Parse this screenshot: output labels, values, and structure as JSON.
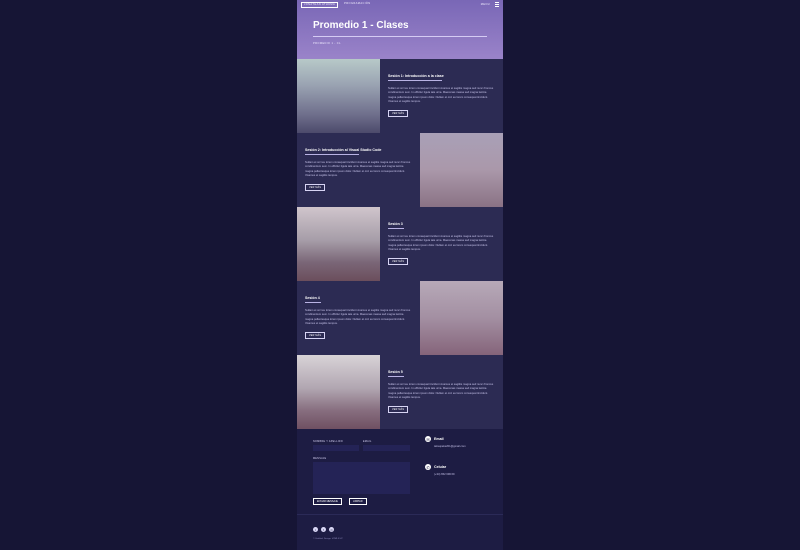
{
  "nav": {
    "left": [
      "JONATHAN ATHUMA",
      "PROGRAMACIÓN"
    ],
    "right": "MENU",
    "menu_icon": "menu-icon"
  },
  "hero": {
    "title": "Promedio 1 - Clases",
    "breadcrumb": "PROMEDIO 1 - CL"
  },
  "sections": [
    {
      "title": "Sesión 1: Introducción a la clase",
      "text": "Nullam et orci eu lorem consequat tincidunt vivamus et sagittis magna sed nunc rhoncus condimentum sem. In efficitur ligula tate urna. Maecenas massa sed magna lacinia magna pellentesque lorem ipsum dolor. Nullam et orci eu lorem consequat tincidunt. Vivamus et sagittis tempus.",
      "button": "VER MÁS"
    },
    {
      "title": "Sesión 2: Introducción al Visual Studio Code",
      "text": "Nullam et orci eu lorem consequat tincidunt vivamus et sagittis magna sed nunc rhoncus condimentum sem. In efficitur ligula tate urna. Maecenas massa sed magna lacinia magna pellentesque lorem ipsum dolor. Nullam et orci eu lorem consequat tincidunt. Vivamus et sagittis tempus.",
      "button": "VER MÁS"
    },
    {
      "title": "Sesión 3",
      "text": "Nullam et orci eu lorem consequat tincidunt vivamus et sagittis magna sed nunc rhoncus condimentum sem. In efficitur ligula tate urna. Maecenas massa sed magna lacinia magna pellentesque lorem ipsum dolor. Nullam et orci eu lorem consequat tincidunt. Vivamus et sagittis tempus.",
      "button": "VER MÁS"
    },
    {
      "title": "Sesión 4",
      "text": "Nullam et orci eu lorem consequat tincidunt vivamus et sagittis magna sed nunc rhoncus condimentum sem. In efficitur ligula tate urna. Maecenas massa sed magna lacinia magna pellentesque lorem ipsum dolor. Nullam et orci eu lorem consequat tincidunt. Vivamus et sagittis tempus.",
      "button": "VER MÁS"
    },
    {
      "title": "Sesión 5",
      "text": "Nullam et orci eu lorem consequat tincidunt vivamus et sagittis magna sed nunc rhoncus condimentum sem. In efficitur ligula tate urna. Maecenas massa sed magna lacinia magna pellentesque lorem ipsum dolor. Nullam et orci eu lorem consequat tincidunt. Vivamus et sagittis tempus.",
      "button": "VER MÁS"
    }
  ],
  "contact": {
    "name_label": "NOMBRE Y APELLIDO",
    "email_label": "EMAIL",
    "message_label": "MENSAJE",
    "send_button": "ENVIAR MENSAJE",
    "clear_button": "LIMPIAR",
    "email_title": "Email",
    "email_value": "teksupeks201@gmail.com",
    "phone_title": "Celular",
    "phone_value": "(+34) 652 696 69"
  },
  "footer": {
    "note": "© Untitled. Design: HTML5 UP"
  },
  "colors": {
    "background": "#161535",
    "page": "#1d1c43",
    "section": "#2c2b53",
    "accent": "#8e76c3"
  }
}
